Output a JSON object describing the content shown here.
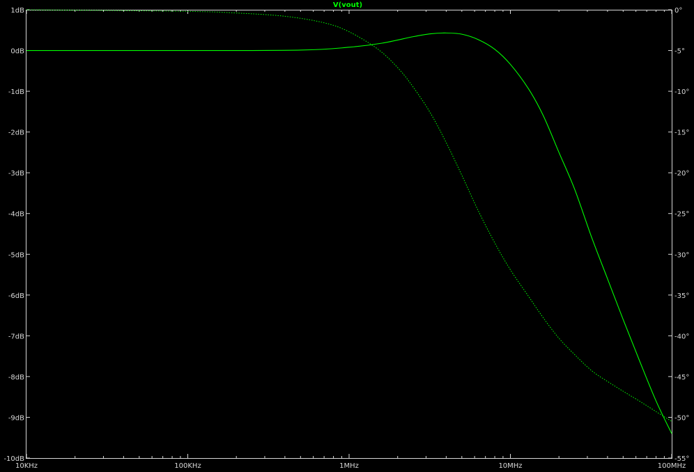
{
  "chart_data": {
    "type": "line",
    "title": "V(vout)",
    "x_scale": "log",
    "xlim_hz": [
      10000,
      100000000
    ],
    "x_ticks": [
      {
        "value": 10000,
        "label": "10KHz"
      },
      {
        "value": 100000,
        "label": "100KHz"
      },
      {
        "value": 1000000,
        "label": "1MHz"
      },
      {
        "value": 10000000,
        "label": "10MHz"
      },
      {
        "value": 100000000,
        "label": "100MHz"
      }
    ],
    "left_axis": {
      "unit": "dB",
      "lim": [
        -10,
        1
      ],
      "ticks": [
        {
          "value": 1,
          "label": "1dB"
        },
        {
          "value": 0,
          "label": "0dB"
        },
        {
          "value": -1,
          "label": "-1dB"
        },
        {
          "value": -2,
          "label": "-2dB"
        },
        {
          "value": -3,
          "label": "-3dB"
        },
        {
          "value": -4,
          "label": "-4dB"
        },
        {
          "value": -5,
          "label": "-5dB"
        },
        {
          "value": -6,
          "label": "-6dB"
        },
        {
          "value": -7,
          "label": "-7dB"
        },
        {
          "value": -8,
          "label": "-8dB"
        },
        {
          "value": -9,
          "label": "-9dB"
        },
        {
          "value": -10,
          "label": "-10dB"
        }
      ]
    },
    "right_axis": {
      "unit": "degrees",
      "lim": [
        -55,
        0
      ],
      "ticks": [
        {
          "value": 0,
          "label": "0°"
        },
        {
          "value": -5,
          "label": "-5°"
        },
        {
          "value": -10,
          "label": "-10°"
        },
        {
          "value": -15,
          "label": "-15°"
        },
        {
          "value": -20,
          "label": "-20°"
        },
        {
          "value": -25,
          "label": "-25°"
        },
        {
          "value": -30,
          "label": "-30°"
        },
        {
          "value": -35,
          "label": "-35°"
        },
        {
          "value": -40,
          "label": "-40°"
        },
        {
          "value": -45,
          "label": "-45°"
        },
        {
          "value": -50,
          "label": "-50°"
        },
        {
          "value": -55,
          "label": "-55°"
        }
      ]
    },
    "grid": false,
    "series": [
      {
        "quantity": "magnitude",
        "axis": "left",
        "style": "solid",
        "color": "#00ff00",
        "x": [
          10000,
          100000,
          500000,
          1000000,
          1600000,
          2500000,
          3200000,
          4000000,
          5000000,
          6300000,
          8000000,
          10000000,
          13000000,
          16000000,
          20000000,
          25000000,
          32000000,
          40000000,
          50000000,
          63000000,
          80000000,
          100000000
        ],
        "y": [
          0,
          0,
          0.01,
          0.08,
          0.18,
          0.34,
          0.41,
          0.43,
          0.4,
          0.27,
          0.03,
          -0.34,
          -0.95,
          -1.6,
          -2.5,
          -3.4,
          -4.6,
          -5.6,
          -6.6,
          -7.6,
          -8.6,
          -9.4
        ]
      },
      {
        "quantity": "phase",
        "axis": "right",
        "style": "dotted",
        "color": "#00ff00",
        "x": [
          10000,
          100000,
          200000,
          400000,
          700000,
          1000000,
          1500000,
          2000000,
          2500000,
          3200000,
          4000000,
          5000000,
          6300000,
          8000000,
          10000000,
          13000000,
          16000000,
          20000000,
          25000000,
          32000000,
          40000000,
          50000000,
          63000000,
          80000000,
          100000000
        ],
        "y": [
          0,
          -0.2,
          -0.4,
          -0.8,
          -1.6,
          -2.7,
          -4.8,
          -7.1,
          -9.5,
          -12.7,
          -16.3,
          -20.3,
          -24.6,
          -28.6,
          -31.9,
          -35.2,
          -37.8,
          -40.3,
          -42.3,
          -44.3,
          -45.6,
          -46.8,
          -48.0,
          -49.3,
          -50.5
        ]
      }
    ]
  }
}
